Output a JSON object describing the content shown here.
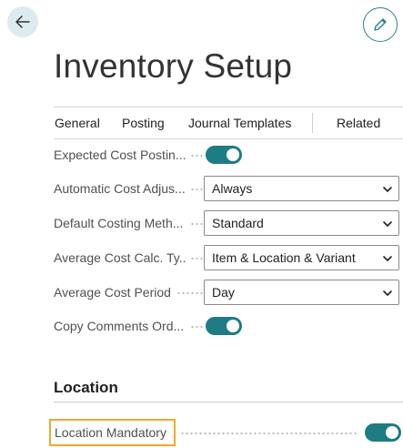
{
  "header": {
    "back_icon": "arrow-left-icon",
    "edit_icon": "pencil-icon",
    "title": "Inventory Setup"
  },
  "tabs": {
    "general": "General",
    "posting": "Posting",
    "journal_templates": "Journal Templates",
    "related": "Related"
  },
  "fields": [
    {
      "label": "Expected Cost Postin...",
      "type": "toggle",
      "value": true
    },
    {
      "label": "Automatic Cost Adjus...",
      "type": "select",
      "value": "Always"
    },
    {
      "label": "Default Costing Meth...",
      "type": "select",
      "value": "Standard"
    },
    {
      "label": "Average Cost Calc. Ty...",
      "type": "select",
      "value": "Item & Location & Variant"
    },
    {
      "label": "Average Cost Period",
      "type": "select",
      "value": "Day"
    },
    {
      "label": "Copy Comments Ord...",
      "type": "toggle",
      "value": true
    }
  ],
  "location_section": {
    "title": "Location",
    "location_mandatory_label": "Location Mandatory",
    "location_mandatory_value": true
  },
  "colors": {
    "accent": "#1e7c84",
    "highlight": "#f0a92c",
    "back_button_bg": "#dcebef"
  }
}
